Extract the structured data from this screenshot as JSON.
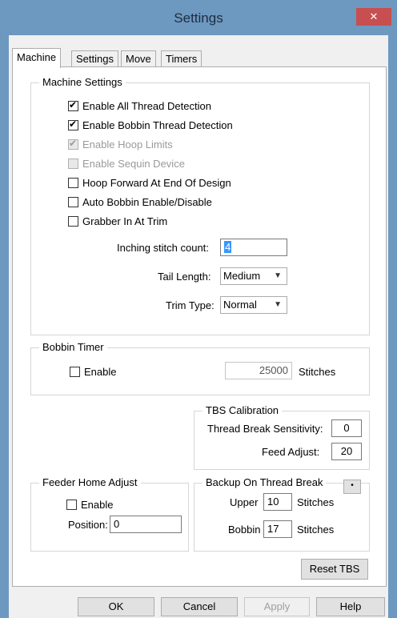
{
  "window": {
    "title": "Settings",
    "close_glyph": "✕"
  },
  "tabs": [
    "Machine",
    "Settings",
    "Move",
    "Timers"
  ],
  "machine_settings": {
    "legend": "Machine Settings",
    "checkboxes": [
      {
        "label": "Enable All Thread Detection",
        "checked": true,
        "disabled": false
      },
      {
        "label": "Enable Bobbin Thread Detection",
        "checked": true,
        "disabled": false
      },
      {
        "label": "Enable Hoop Limits",
        "checked": true,
        "disabled": true
      },
      {
        "label": "Enable Sequin Device",
        "checked": false,
        "disabled": true
      },
      {
        "label": "Hoop Forward At End Of Design",
        "checked": false,
        "disabled": false
      },
      {
        "label": "Auto Bobbin Enable/Disable",
        "checked": false,
        "disabled": false
      },
      {
        "label": "Grabber In At Trim",
        "checked": false,
        "disabled": false
      }
    ],
    "inching_label": "Inching stitch count:",
    "inching_value": "4",
    "tail_label": "Tail Length:",
    "tail_value": "Medium",
    "trim_label": "Trim Type:",
    "trim_value": "Normal"
  },
  "bobbin_timer": {
    "legend": "Bobbin Timer",
    "enable_label": "Enable",
    "stitches_value": "25000",
    "stitches_label": "Stitches"
  },
  "tbs_calibration": {
    "legend": "TBS Calibration",
    "sensitivity_label": "Thread Break Sensitivity:",
    "sensitivity_value": "0",
    "feed_label": "Feed Adjust:",
    "feed_value": "20"
  },
  "feeder_home": {
    "legend": "Feeder Home Adjust",
    "enable_label": "Enable",
    "position_label": "Position:",
    "position_value": "0"
  },
  "backup": {
    "legend": "Backup On Thread Break",
    "upper_label": "Upper",
    "upper_value": "10",
    "bobbin_label": "Bobbin",
    "bobbin_value": "17",
    "stitches_label": "Stitches",
    "small_button": "•"
  },
  "reset_tbs": "Reset TBS",
  "buttons": {
    "ok": "OK",
    "cancel": "Cancel",
    "apply": "Apply",
    "help": "Help"
  },
  "colors": {
    "title_bar": "#6d98c0",
    "close": "#c74f50",
    "highlight_box": "#ffffff"
  }
}
